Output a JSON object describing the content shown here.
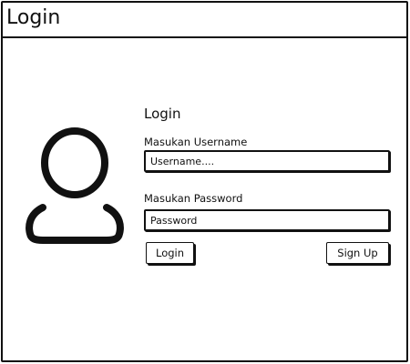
{
  "window": {
    "title": "Login"
  },
  "form": {
    "title": "Login",
    "avatar_icon": "user-icon",
    "username": {
      "label": "Masukan Username",
      "placeholder": "Username....",
      "value": ""
    },
    "password": {
      "label": "Masukan Password",
      "placeholder": "Password",
      "value": ""
    },
    "login_label": "Login",
    "signup_label": "Sign Up"
  },
  "colors": {
    "ink": "#111111",
    "background": "#ffffff"
  }
}
